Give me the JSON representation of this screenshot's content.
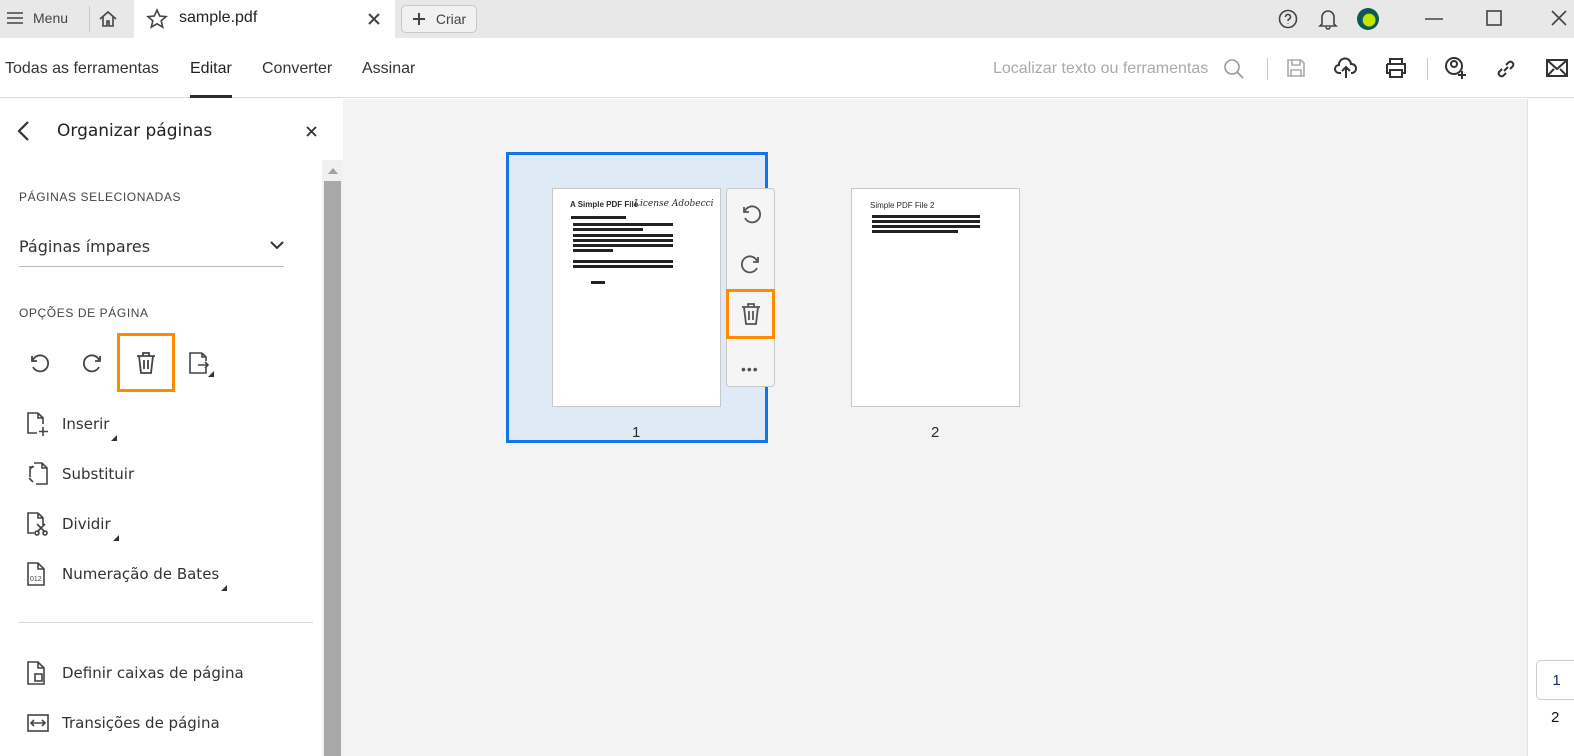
{
  "topbar": {
    "menu_label": "Menu",
    "tab_title": "sample.pdf",
    "create_label": "Criar"
  },
  "toolbar": {
    "tabs": [
      "Todas as ferramentas",
      "Editar",
      "Converter",
      "Assinar"
    ],
    "active_tab": "Editar",
    "search_placeholder": "Localizar texto ou ferramentas"
  },
  "panel": {
    "title": "Organizar páginas",
    "selected_pages_heading": "PÁGINAS SELECIONADAS",
    "selected_pages_value": "Páginas ímpares",
    "page_options_heading": "OPÇÕES DE PÁGINA",
    "options": [
      "Inserir",
      "Substituir",
      "Dividir",
      "Numeração de Bates"
    ],
    "more_options": [
      "Definir caixas de página",
      "Transições de página"
    ]
  },
  "pages": [
    {
      "number": "1",
      "title": "A Simple PDF File",
      "signature": "License Adobecci",
      "selected": true
    },
    {
      "number": "2",
      "title": "Simple PDF File 2",
      "selected": false
    }
  ],
  "page_nav": {
    "pages": [
      "1",
      "2"
    ],
    "current": "1"
  },
  "colors": {
    "accent": "#1473e6",
    "highlight": "#ff8c00",
    "selection_fill": "#deebf7"
  }
}
